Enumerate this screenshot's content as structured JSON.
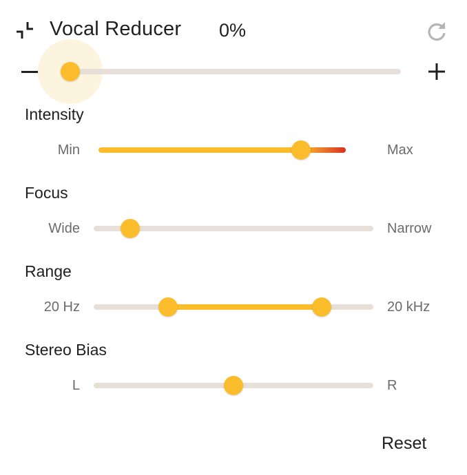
{
  "header": {
    "title": "Vocal Reducer",
    "percent": "0%",
    "collapse_icon": "collapse-arrows-icon",
    "refresh_icon": "refresh-icon"
  },
  "amount": {
    "value": 0,
    "minus_icon": "minus-icon",
    "plus_icon": "plus-icon"
  },
  "intensity": {
    "label": "Intensity",
    "min_label": "Min",
    "max_label": "Max",
    "value": 0.82
  },
  "focus": {
    "label": "Focus",
    "min_label": "Wide",
    "max_label": "Narrow",
    "value": 0.13
  },
  "range": {
    "label": "Range",
    "min_label": "20 Hz",
    "max_label": "20 kHz",
    "low": 0.265,
    "high": 0.815
  },
  "stereo_bias": {
    "label": "Stereo Bias",
    "min_label": "L",
    "max_label": "R",
    "value": 0.5
  },
  "reset_label": "Reset",
  "colors": {
    "accent": "#fbbd2c",
    "track": "#e6e0d8",
    "danger": "#d93025",
    "halo": "#fdf4df"
  }
}
